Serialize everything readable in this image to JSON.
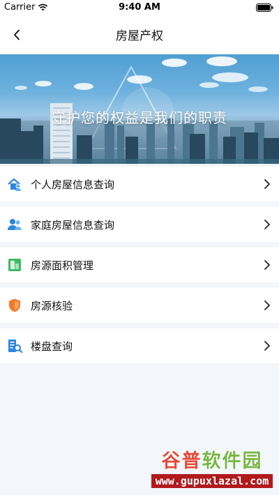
{
  "status_bar": {
    "carrier": "Carrier",
    "time": "9:40 AM"
  },
  "nav": {
    "title": "房屋产权",
    "back_icon": "chevron-left-icon"
  },
  "banner": {
    "slogan": "守护您的权益是我们的职责"
  },
  "menu": {
    "items": [
      {
        "label": "个人房屋信息查询",
        "icon": "house-person-icon",
        "color": "#2b86de"
      },
      {
        "label": "家庭房屋信息查询",
        "icon": "family-icon",
        "color": "#2b86de"
      },
      {
        "label": "房源面积管理",
        "icon": "area-chart-icon",
        "color": "#3cb964"
      },
      {
        "label": "房源核验",
        "icon": "shield-check-icon",
        "color": "#f07a2a"
      },
      {
        "label": "楼盘查询",
        "icon": "building-search-icon",
        "color": "#2b86de"
      }
    ]
  },
  "watermark": {
    "top_a": "谷普",
    "top_b": "软件园",
    "bottom": "www.gupuxlazal.com"
  }
}
